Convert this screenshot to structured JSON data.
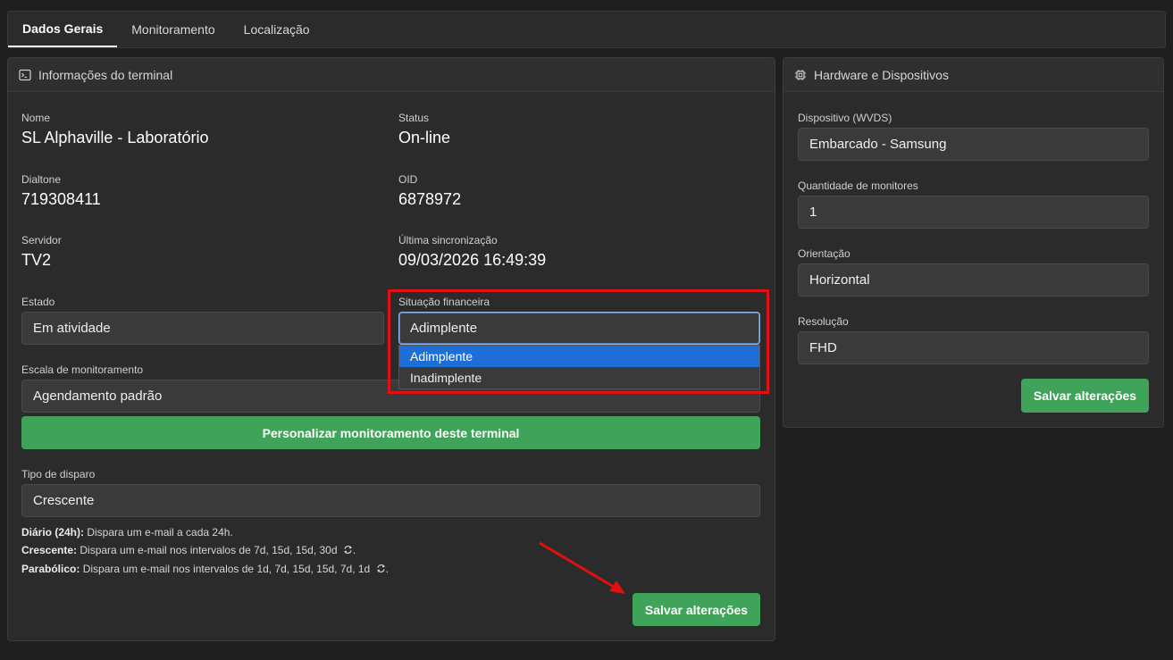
{
  "tabs": [
    {
      "label": "Dados Gerais",
      "active": true
    },
    {
      "label": "Monitoramento"
    },
    {
      "label": "Localização"
    }
  ],
  "terminal": {
    "header": "Informações do terminal",
    "nome_label": "Nome",
    "nome_value": "SL Alphaville - Laboratório",
    "status_label": "Status",
    "status_value": "On-line",
    "dialtone_label": "Dialtone",
    "dialtone_value": "719308411",
    "oid_label": "OID",
    "oid_value": "6878972",
    "servidor_label": "Servidor",
    "servidor_value": "TV2",
    "sync_label": "Última sincronização",
    "sync_value": "09/03/2026 16:49:39",
    "estado_label": "Estado",
    "estado_value": "Em atividade",
    "financeira_label": "Situação financeira",
    "financeira_value": "Adimplente",
    "financeira_options": [
      "Adimplente",
      "Inadimplente"
    ],
    "escala_label": "Escala de monitoramento",
    "escala_value": "Agendamento padrão",
    "personalizar_button": "Personalizar monitoramento deste terminal",
    "disparo_label": "Tipo de disparo",
    "disparo_value": "Crescente",
    "help": {
      "diario_term": "Diário (24h):",
      "diario_text": " Dispara um e-mail a cada 24h.",
      "crescente_term": "Crescente:",
      "crescente_text": " Dispara um e-mail nos intervalos de 7d, 15d, 15d, 30d",
      "parabolico_term": "Parabólico:",
      "parabolico_text": " Dispara um e-mail nos intervalos de 1d, 7d, 15d, 15d, 7d, 1d"
    },
    "save_button": "Salvar alterações"
  },
  "hardware": {
    "header": "Hardware e Dispositivos",
    "dispositivo_label": "Dispositivo (WVDS)",
    "dispositivo_value": "Embarcado - Samsung",
    "monitores_label": "Quantidade de monitores",
    "monitores_value": "1",
    "orientacao_label": "Orientação",
    "orientacao_value": "Horizontal",
    "resolucao_label": "Resolução",
    "resolucao_value": "FHD",
    "save_button": "Salvar alterações"
  },
  "colors": {
    "accent_green": "#3fa35a",
    "selected_blue": "#1e6ed8",
    "annotation_red": "#e01010"
  }
}
